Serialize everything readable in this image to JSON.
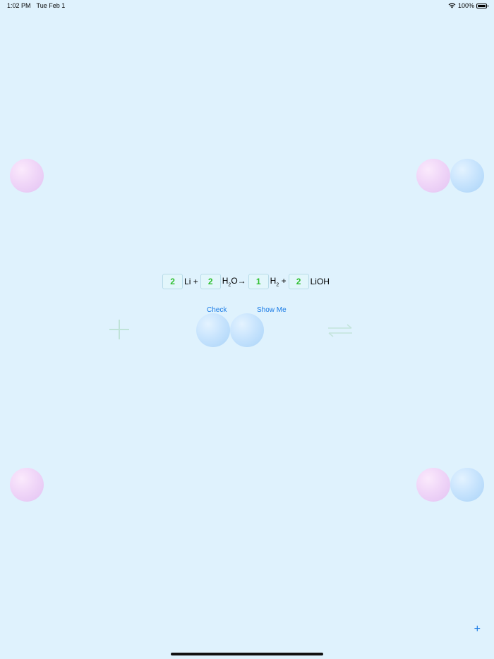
{
  "status_bar": {
    "time": "1:02 PM",
    "date": "Tue Feb 1",
    "battery_percent": "100%",
    "icons": [
      "wifi-icon",
      "battery-icon"
    ]
  },
  "equation": {
    "terms": [
      {
        "coefficient": "2",
        "formula": "Li",
        "operator": "+"
      },
      {
        "coefficient": "2",
        "formula": "H",
        "subscript": "2",
        "formula_rest": "O",
        "operator": "→"
      },
      {
        "coefficient": "1",
        "formula": "H",
        "subscript": "2",
        "operator": "+"
      },
      {
        "coefficient": "2",
        "formula": "LiOH"
      }
    ]
  },
  "actions": {
    "check_label": "Check",
    "show_me_label": "Show Me",
    "add_label": "+"
  },
  "colors": {
    "background": "#dff2fd",
    "coefficient_text": "#2ebf2e",
    "link": "#1a7be6"
  }
}
